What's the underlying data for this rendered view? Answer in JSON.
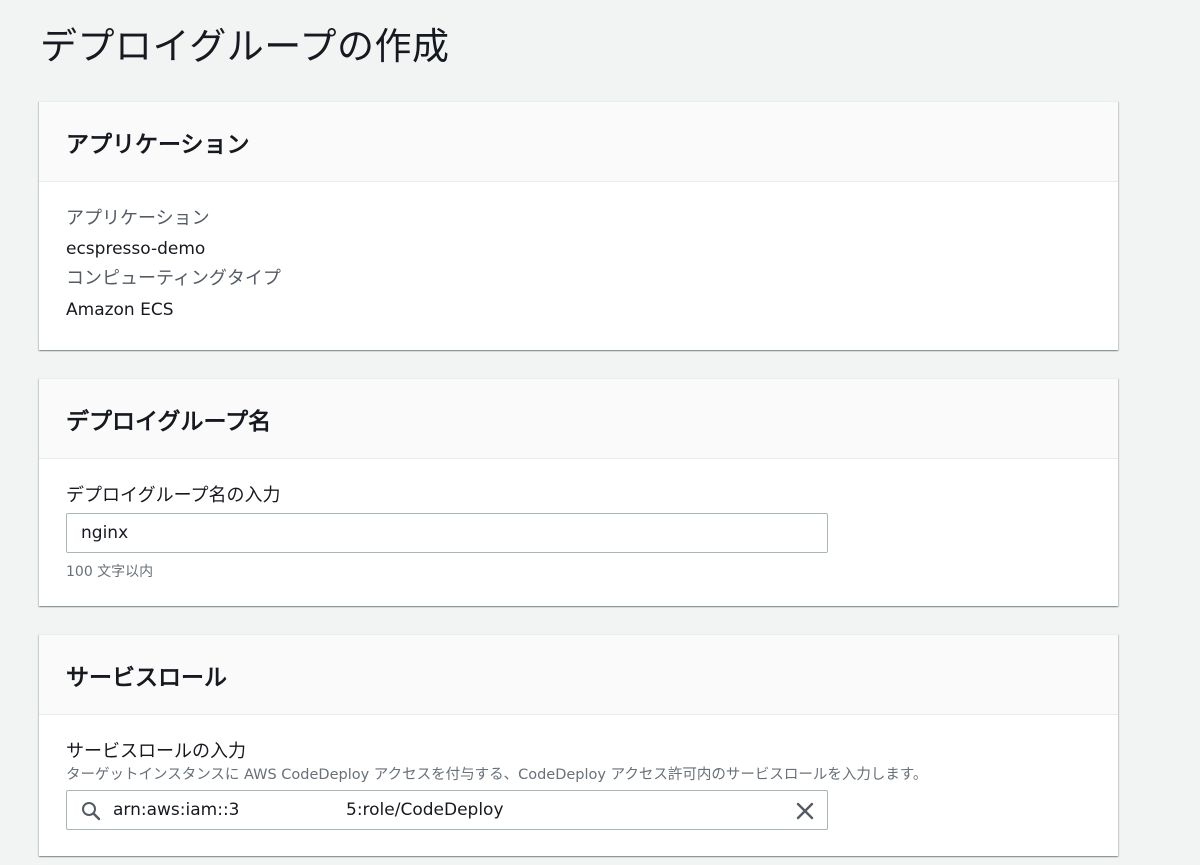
{
  "page": {
    "title": "デプロイグループの作成"
  },
  "application_section": {
    "header": "アプリケーション",
    "app_label": "アプリケーション",
    "app_value": "ecspresso-demo",
    "compute_label": "コンピューティングタイプ",
    "compute_value": "Amazon ECS"
  },
  "deploy_group_section": {
    "header": "デプロイグループ名",
    "input_label": "デプロイグループ名の入力",
    "input_value": "nginx",
    "constraint": "100 文字以内"
  },
  "service_role_section": {
    "header": "サービスロール",
    "input_label": "サービスロールの入力",
    "description": "ターゲットインスタンスに AWS CodeDeploy アクセスを付与する、CodeDeploy アクセス許可内のサービスロールを入力します。",
    "value_prefix": "arn:aws:iam::3",
    "value_suffix": "5:role/CodeDeploy",
    "icons": {
      "search": "search-icon",
      "clear": "close-icon"
    }
  }
}
